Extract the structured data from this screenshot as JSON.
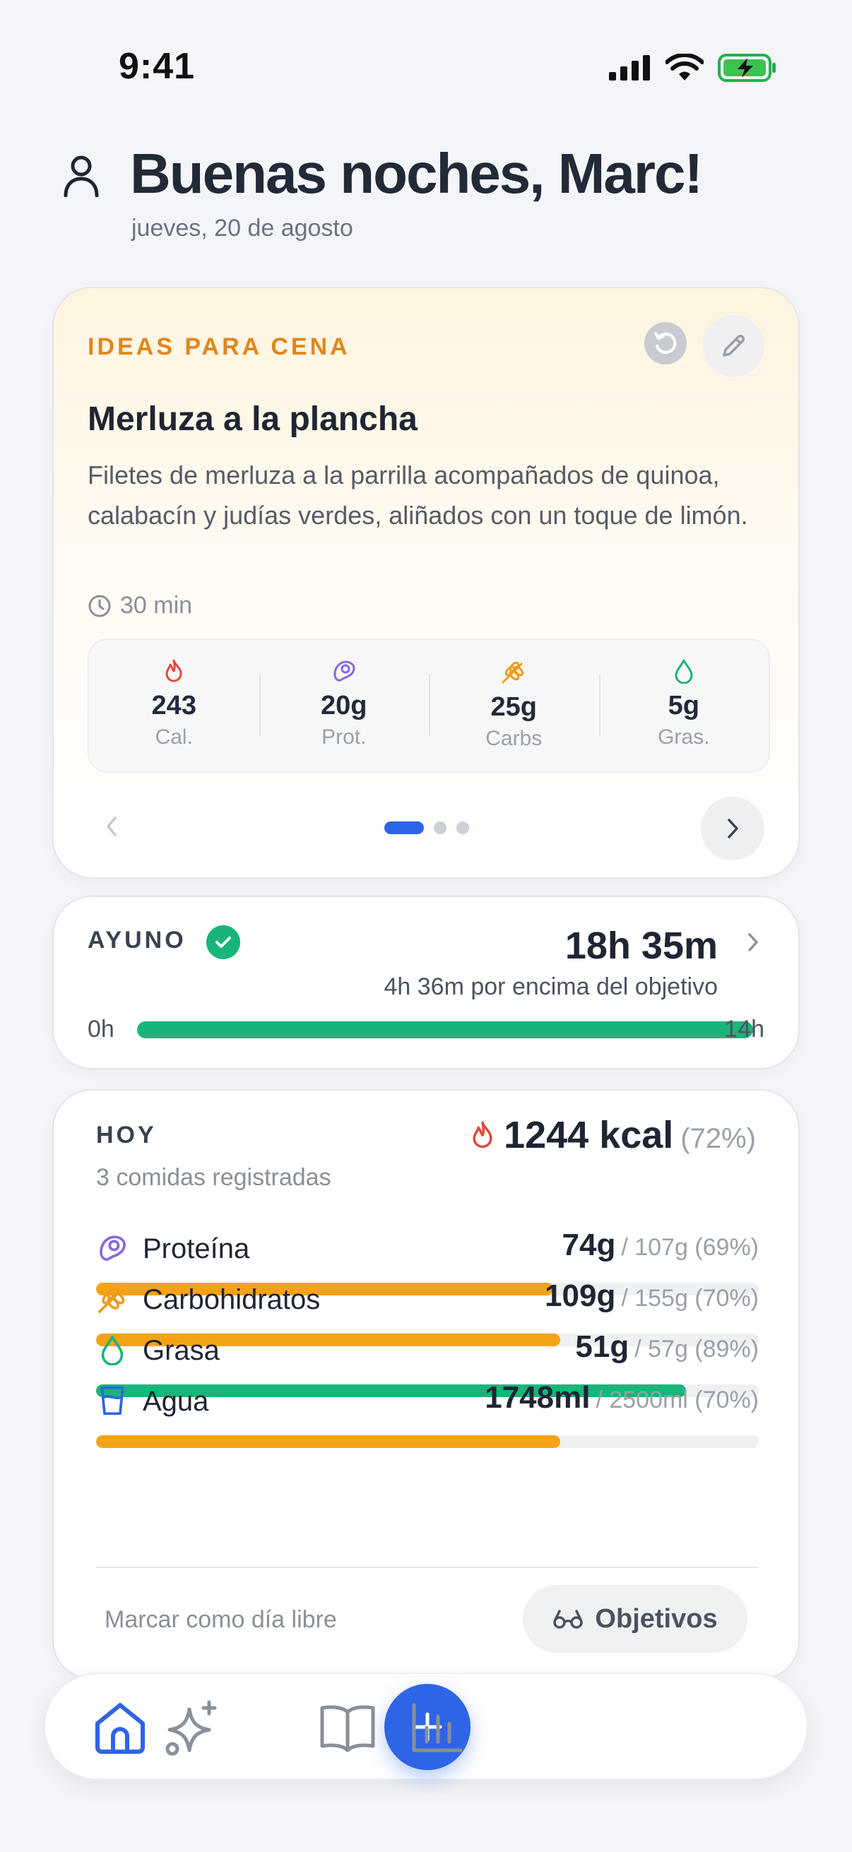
{
  "status_bar": {
    "time": "9:41"
  },
  "header": {
    "greeting": "Buenas noches, Marc!",
    "date": "jueves, 20 de agosto"
  },
  "ideas": {
    "title": "IDEAS PARA CENA",
    "recipe_name": "Merluza a la plancha",
    "description": "Filetes de merluza a la parrilla acompañados de quinoa, calabacín y judías verdes, aliñados con un toque de limón.",
    "time": "30 min",
    "macros": [
      {
        "value": "243",
        "label": "Cal.",
        "icon": "flame-icon",
        "color": "#e5483b"
      },
      {
        "value": "20g",
        "label": "Prot.",
        "icon": "meat-icon",
        "color": "#8a67e0"
      },
      {
        "value": "25g",
        "label": "Carbs",
        "icon": "wheat-icon",
        "color": "#f09b1a"
      },
      {
        "value": "5g",
        "label": "Gras.",
        "icon": "drop-icon",
        "color": "#18b57a"
      }
    ],
    "pagination": {
      "current": 1,
      "total": 3
    }
  },
  "fasting": {
    "label": "AYUNO",
    "value": "18h 35m",
    "subtitle": "4h 36m por encima del objetivo",
    "start": "0h",
    "end": "14h",
    "progress": 1.0,
    "color": "#18b57a"
  },
  "today": {
    "label": "HOY",
    "meals": "3 comidas registradas",
    "kcal": "1244 kcal",
    "kcal_pct": "(72%)",
    "nutrients": [
      {
        "name": "Proteína",
        "current": "74g",
        "goal": "/ 107g (69%)",
        "progress": 0.69,
        "color": "#f5a316",
        "icon": "meat-icon"
      },
      {
        "name": "Carbohidratos",
        "current": "109g",
        "goal": "/ 155g (70%)",
        "progress": 0.7,
        "color": "#f5a316",
        "icon": "wheat-icon"
      },
      {
        "name": "Grasa",
        "current": "51g",
        "goal": "/ 57g (89%)",
        "progress": 0.89,
        "color": "#18b57a",
        "icon": "drop-icon"
      },
      {
        "name": "Agua",
        "current": "1748ml",
        "goal": "/ 2500ml (70%)",
        "progress": 0.7,
        "color": "#f5a316",
        "icon": "glass-icon"
      }
    ],
    "free_day": "Marcar como día libre",
    "goals_button": "Objetivos"
  },
  "colors": {
    "accent": "#2e64e6",
    "ideas_title": "#e0861c"
  }
}
